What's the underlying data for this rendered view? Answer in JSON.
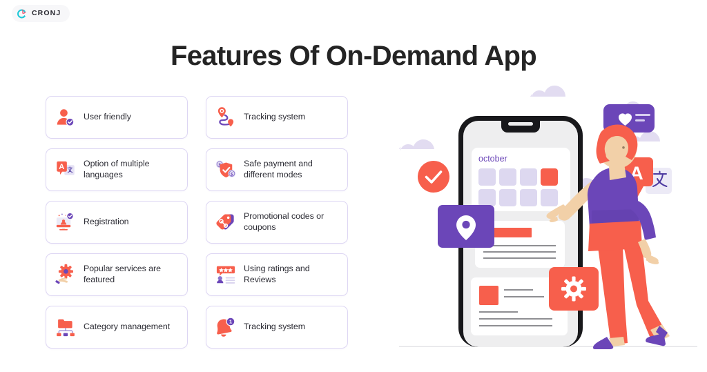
{
  "brand": {
    "logo_text": "CRONJ",
    "logo_icon": "cronj-clock-icon",
    "accent_cyan": "#1ec8d8",
    "accent_pink": "#f0506e"
  },
  "header": {
    "title": "Features Of On-Demand App"
  },
  "colors": {
    "coral": "#f75f4c",
    "purple": "#6b46b8",
    "lavender": "#ddd6f3",
    "lavender_light": "#e2ddf2",
    "text_dark": "#2c2c34",
    "card_border": "#ddd6f3"
  },
  "features": [
    {
      "label": "User friendly",
      "icon": "user-check-icon",
      "column": "left",
      "row": 1
    },
    {
      "label": "Option of multiple languages",
      "icon": "translate-icon",
      "column": "left",
      "row": 2
    },
    {
      "label": "Registration",
      "icon": "monitor-register-icon",
      "column": "left",
      "row": 3
    },
    {
      "label": "Popular services are featured",
      "icon": "hand-gear-icon",
      "column": "left",
      "row": 4
    },
    {
      "label": "Category management",
      "icon": "folder-hierarchy-icon",
      "column": "left",
      "row": 5
    },
    {
      "label": "Tracking system",
      "icon": "route-pin-icon",
      "column": "right",
      "row": 1
    },
    {
      "label": "Safe payment and different modes",
      "icon": "shield-coins-icon",
      "column": "right",
      "row": 2
    },
    {
      "label": "Promotional codes or coupons",
      "icon": "discount-tag-icon",
      "column": "right",
      "row": 3
    },
    {
      "label": "Using ratings and Reviews",
      "icon": "stars-review-icon",
      "column": "right",
      "row": 4
    },
    {
      "label": "Tracking system",
      "icon": "bell-notification-icon",
      "column": "right",
      "row": 5
    }
  ],
  "illustration": {
    "phone_screen": {
      "calendar_month": "october",
      "calendar_cells_row1": 4,
      "calendar_cells_row2": 4,
      "selected_cell_index": 4
    },
    "badges": [
      {
        "name": "check-circle-badge",
        "icon": "check-icon"
      },
      {
        "name": "location-pin-badge",
        "icon": "map-pin-icon"
      },
      {
        "name": "gear-badge",
        "icon": "gear-icon"
      },
      {
        "name": "heart-message-bubble",
        "icon": "heart-icon"
      },
      {
        "name": "translate-badge",
        "icon": "translate-icon",
        "letter": "A"
      }
    ],
    "character": "woman-pointing-at-phone"
  }
}
